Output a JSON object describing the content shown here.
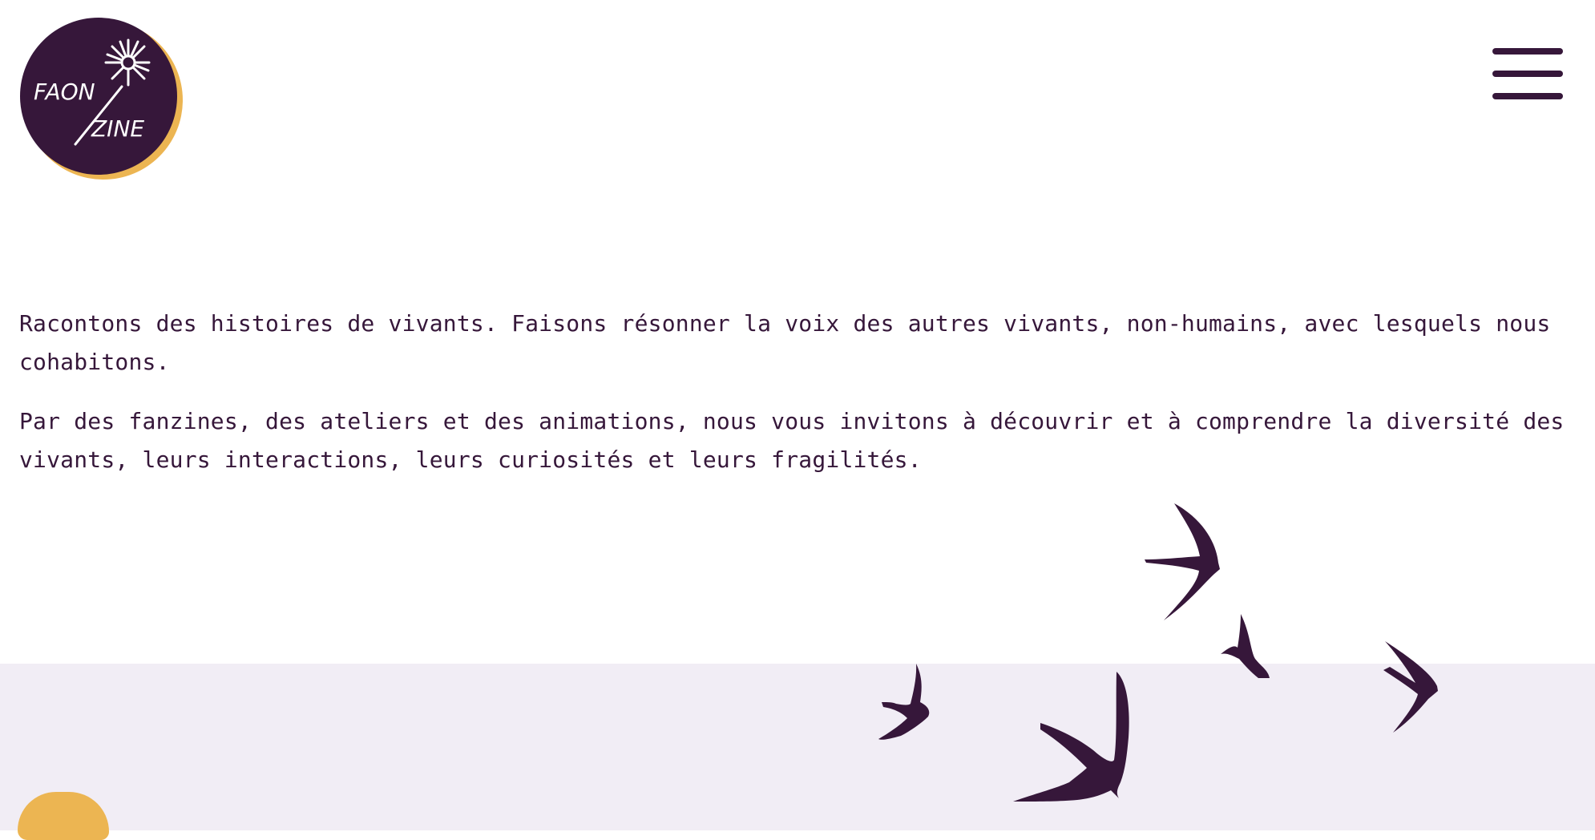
{
  "header": {
    "logo": {
      "text_line1": "FAON",
      "text_line2": "ZINE"
    },
    "menu_icon": "hamburger-menu-icon"
  },
  "intro": {
    "paragraph_1": "Racontons des histoires de vivants. Faisons résonner la voix des autres vivants, non-humains, avec lesquels nous cohabitons.",
    "paragraph_2": "Par des fanzines, des ateliers et des animations, nous vous invitons à découvrir et à comprendre la diversité des vivants, leurs interactions, leurs curiosités et leurs fragilités."
  },
  "decoration": {
    "illustration": "swift-birds-icon",
    "accent_shape": "ochre-blob"
  },
  "colors": {
    "primary": "#36173a",
    "accent": "#ecb552",
    "band_background": "#f1edf5",
    "page_background": "#ffffff"
  }
}
